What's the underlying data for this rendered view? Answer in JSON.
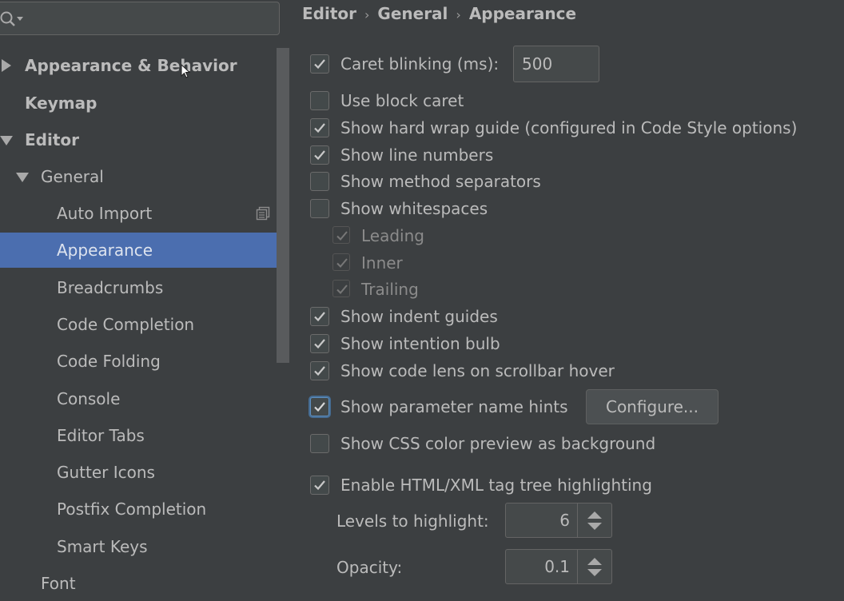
{
  "sidebar": {
    "search": {
      "value": "",
      "placeholder": ""
    },
    "items": [
      {
        "label": "Appearance & Behavior",
        "bold": true,
        "arrow": "right"
      },
      {
        "label": "Keymap",
        "bold": true
      },
      {
        "label": "Editor",
        "bold": true,
        "arrow": "down"
      },
      {
        "label": "General",
        "arrow": "down"
      },
      {
        "label": "Auto Import"
      },
      {
        "label": "Appearance",
        "selected": true
      },
      {
        "label": "Breadcrumbs"
      },
      {
        "label": "Code Completion"
      },
      {
        "label": "Code Folding"
      },
      {
        "label": "Console"
      },
      {
        "label": "Editor Tabs"
      },
      {
        "label": "Gutter Icons"
      },
      {
        "label": "Postfix Completion"
      },
      {
        "label": "Smart Keys"
      },
      {
        "label": "Font"
      }
    ]
  },
  "breadcrumb": [
    "Editor",
    "General",
    "Appearance"
  ],
  "options": {
    "caret_blinking": {
      "label": "Caret blinking (ms):",
      "checked": true,
      "value": "500"
    },
    "block_caret": {
      "label": "Use block caret",
      "checked": false
    },
    "hard_wrap": {
      "label": "Show hard wrap guide (configured in Code Style options)",
      "checked": true
    },
    "line_numbers": {
      "label": "Show line numbers",
      "checked": true
    },
    "method_separators": {
      "label": "Show method separators",
      "checked": false
    },
    "whitespaces": {
      "label": "Show whitespaces",
      "checked": false
    },
    "leading": {
      "label": "Leading",
      "checked": true
    },
    "inner": {
      "label": "Inner",
      "checked": true
    },
    "trailing": {
      "label": "Trailing",
      "checked": true
    },
    "indent_guides": {
      "label": "Show indent guides",
      "checked": true
    },
    "intention_bulb": {
      "label": "Show intention bulb",
      "checked": true
    },
    "code_lens": {
      "label": "Show code lens on scrollbar hover",
      "checked": true
    },
    "param_hints": {
      "label": "Show parameter name hints",
      "checked": true,
      "button": "Configure..."
    },
    "css_preview": {
      "label": "Show CSS color preview as background",
      "checked": false
    },
    "tag_tree": {
      "label": "Enable HTML/XML tag tree highlighting",
      "checked": true
    },
    "levels": {
      "label": "Levels to highlight:",
      "value": "6"
    },
    "opacity": {
      "label": "Opacity:",
      "value": "0.1"
    }
  },
  "colors": {
    "background": "#3c3f41",
    "selection": "#4b6eaf",
    "text": "#bbbbbb"
  }
}
